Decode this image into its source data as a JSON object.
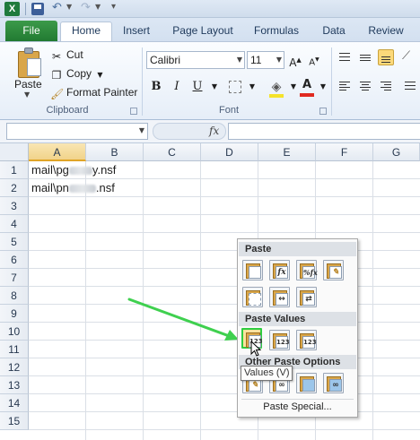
{
  "tabs": [
    {
      "label": "File"
    },
    {
      "label": "Home"
    },
    {
      "label": "Insert"
    },
    {
      "label": "Page Layout"
    },
    {
      "label": "Formulas"
    },
    {
      "label": "Data"
    },
    {
      "label": "Review"
    }
  ],
  "clipboard": {
    "paste_label": "Paste",
    "cut_label": "Cut",
    "copy_label": "Copy",
    "format_painter_label": "Format Painter",
    "group_label": "Clipboard"
  },
  "font": {
    "family": "Calibri",
    "size": "11",
    "bold_label": "B",
    "italic_label": "I",
    "underline_label": "U",
    "group_label": "Font"
  },
  "formula_bar": {
    "fx_label": "fx"
  },
  "grid": {
    "columns": [
      "A",
      "B",
      "C",
      "D",
      "E",
      "F",
      "G"
    ],
    "rows": [
      "1",
      "2",
      "3",
      "4",
      "5",
      "6",
      "7",
      "8",
      "9",
      "10",
      "11",
      "12",
      "13",
      "14",
      "15"
    ],
    "cells": [
      {
        "prefix": "mail\\pg",
        "suffix": "y.nsf"
      },
      {
        "prefix": "mail\\pn",
        "suffix": ".nsf"
      }
    ]
  },
  "context_menu": {
    "paste_header": "Paste",
    "paste_values_header": "Paste Values",
    "other_header": "Other Paste Options",
    "value_icon_text": "123",
    "formula_icon_text": "fx",
    "percent_fx_text": "%fx",
    "paste_special": "Paste Special..."
  },
  "tooltip": {
    "text": "Values (V)"
  },
  "colors": {
    "file_tab": "#217a31",
    "highlight": "#2ecc40",
    "arrow": "#3fd04f"
  }
}
